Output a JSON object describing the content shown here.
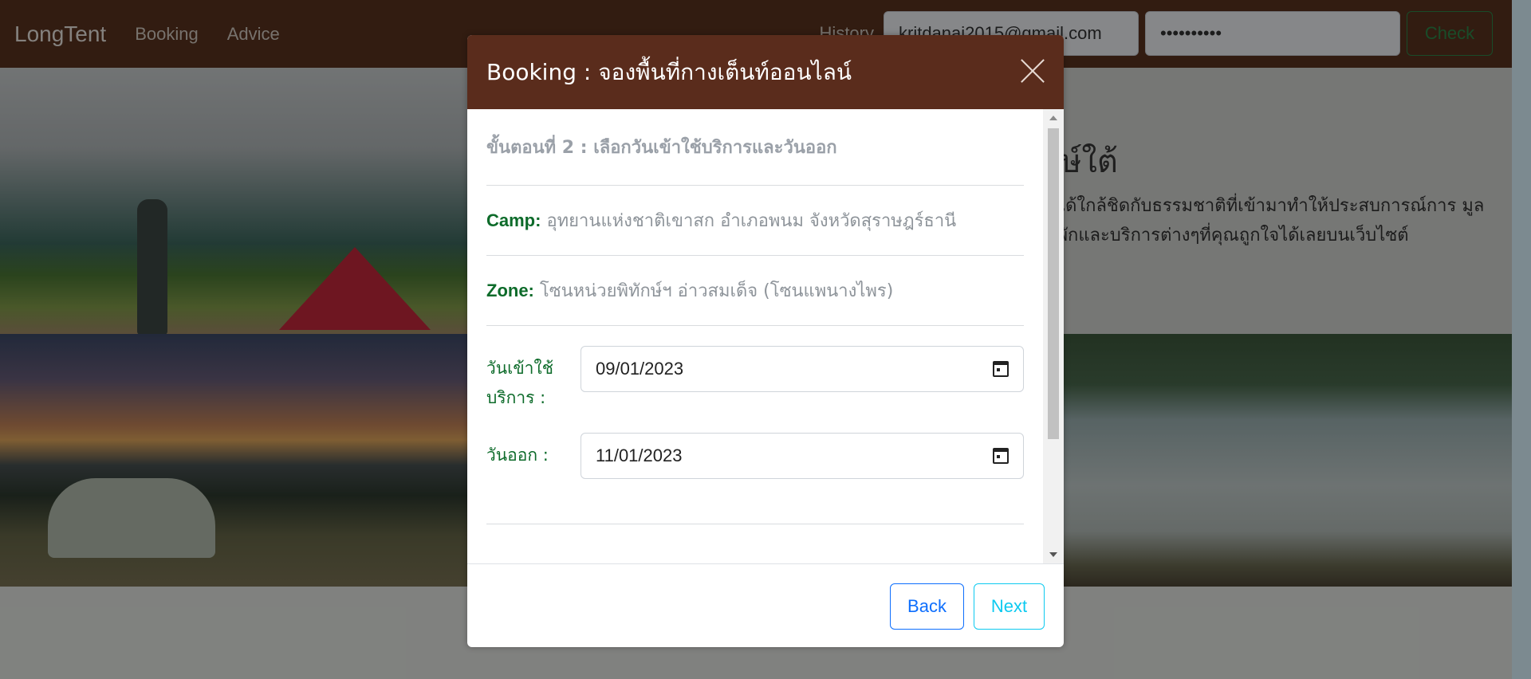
{
  "navbar": {
    "brand": "LongTent",
    "links": [
      "Booking",
      "Advice"
    ],
    "history_label": "History",
    "email_value": "kritdanai2015@gmail.com",
    "password_value": "••••••••••",
    "check_label": "Check"
  },
  "background": {
    "hero_title": "ษ์ใต้",
    "hero_text": "นได้ใกล้ชิดกับธรรมชาติที่เข้ามาทำให้ประสบการณ์การ มูลที่พักและบริการต่างๆที่คุณถูกใจได้เลยบนเว็บไซต์"
  },
  "modal": {
    "title": "Booking : จองพื้นที่กางเต็นท์ออนไลน์",
    "step_title": "ขั้นตอนที่ 2 : เลือกวันเข้าใช้บริการและวันออก",
    "camp_label": "Camp:",
    "camp_value": "อุทยานแห่งชาติเขาสก อำเภอพนม จังหวัดสุราษฎร์ธานี",
    "zone_label": "Zone:",
    "zone_value": "โซนหน่วยพิทักษ์ฯ อ่าวสมเด็จ (โซนแพนางไพร)",
    "checkin_label": "วันเข้าใช้บริการ :",
    "checkin_value": "09/01/2023",
    "checkout_label": "วันออก :",
    "checkout_value": "11/01/2023",
    "back_label": "Back",
    "next_label": "Next"
  },
  "colors": {
    "navbar": "#5c3320",
    "modal_header": "#5a2c1c",
    "label_green": "#0d6b2a",
    "back_blue": "#0d6efd",
    "next_cyan": "#0dcaf0"
  },
  "icons": [
    "close-icon",
    "calendar-icon"
  ]
}
